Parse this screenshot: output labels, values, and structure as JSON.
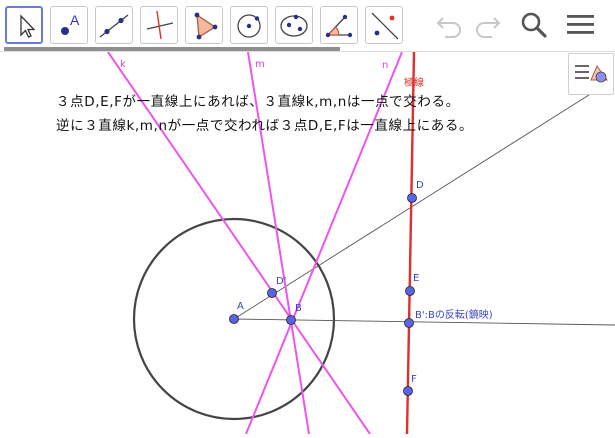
{
  "toolbar": {
    "tools": [
      "move-tool",
      "point-tool",
      "line-tool",
      "perpendicular-line-tool",
      "polygon-tool",
      "circle-tool",
      "conic-tool",
      "angle-tool",
      "reflect-tool"
    ],
    "point_tool_letter": "A",
    "active_tool": "move-tool"
  },
  "graphics": {
    "line_labels": {
      "k": "k",
      "m": "m",
      "n": "n"
    },
    "polar_label": "極線",
    "point_labels": {
      "D": "D",
      "E": "E",
      "F": "F",
      "A": "A",
      "B": "B",
      "Dp": "D'"
    },
    "inversion_label": "B':Bの反転(鏡映)",
    "text_line1": "３点D,E,Fが一直線上にあれば、３直線k,m,nは一点で交わる。",
    "text_line2": "逆に３直線k,m,nが一点で交われば３点D,E,Fは一直線上にある。"
  },
  "colors": {
    "accent": "#6c7bd6",
    "magenta_lines": "#ee55ee",
    "polar_line": "#e0302c",
    "point_fill": "#5a64e6",
    "circle": "#444444"
  }
}
